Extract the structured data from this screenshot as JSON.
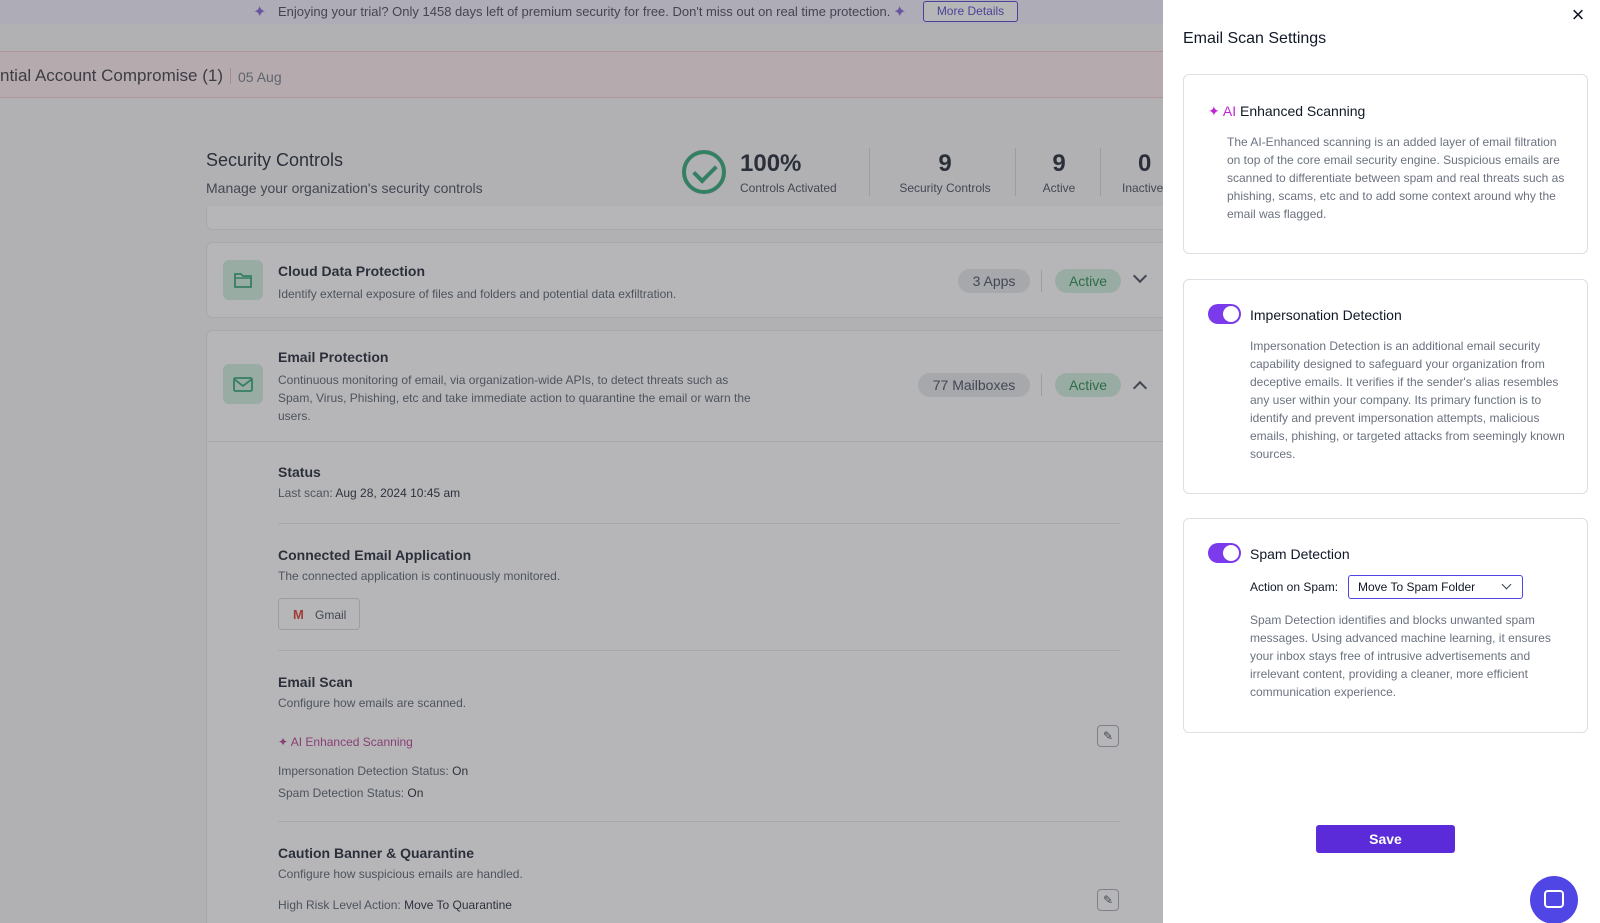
{
  "trial_banner": {
    "message": "Enjoying your trial? Only 1458 days left of premium security for free. Don't miss out on real time protection.",
    "button": "More Details"
  },
  "alert": {
    "title": "ntial Account Compromise (1)",
    "date": "05 Aug"
  },
  "security_controls": {
    "title": "Security Controls",
    "subtitle": "Manage your organization's security controls",
    "stats": [
      {
        "value": "100%",
        "label": "Controls Activated"
      },
      {
        "value": "9",
        "label": "Security Controls"
      },
      {
        "value": "9",
        "label": "Active"
      },
      {
        "value": "0",
        "label": "Inactive"
      }
    ]
  },
  "cloud_card": {
    "title": "Cloud Data Protection",
    "desc": "Identify external exposure of files and folders and potential data exfiltration.",
    "count": "3 Apps",
    "status": "Active"
  },
  "email_card": {
    "title": "Email Protection",
    "desc": "Continuous monitoring of email, via organization-wide APIs, to detect threats such as Spam, Virus, Phishing, etc and take immediate action to quarantine the email or warn the users.",
    "count": "77 Mailboxes",
    "status": "Active"
  },
  "status_section": {
    "title": "Status",
    "last_scan_label": "Last scan:",
    "last_scan_value": "Aug 28, 2024 10:45 am"
  },
  "connected_section": {
    "title": "Connected Email Application",
    "sub": "The connected application is continuously monitored.",
    "app": "Gmail"
  },
  "email_scan_section": {
    "title": "Email Scan",
    "sub": "Configure how emails are scanned.",
    "ai_label": "AI Enhanced Scanning",
    "impersonation_label": "Impersonation Detection Status:",
    "impersonation_value": "On",
    "spam_label": "Spam Detection Status:",
    "spam_value": "On"
  },
  "caution_section": {
    "title": "Caution Banner & Quarantine",
    "sub": "Configure how suspicious emails are handled.",
    "high_risk_label": "High Risk Level Action:",
    "high_risk_value": "Move To Quarantine"
  },
  "drawer": {
    "title": "Email Scan Settings",
    "ai_panel": {
      "badge": "AI",
      "title": "Enhanced Scanning",
      "desc": "The AI-Enhanced scanning is an added layer of email filtration on top of the core email security engine. Suspicious emails are scanned to differentiate between spam and real threats such as phishing, scams, etc and to add some context around why the email was flagged."
    },
    "impersonation_panel": {
      "title": "Impersonation Detection",
      "enabled": true,
      "desc": "Impersonation Detection is an additional email security capability designed to safeguard your organization from deceptive emails. It verifies if the sender's alias resembles any user within your company. Its primary function is to identify and prevent impersonation attempts, malicious emails, phishing, or targeted attacks from seemingly known sources."
    },
    "spam_panel": {
      "title": "Spam Detection",
      "enabled": true,
      "action_label": "Action on Spam:",
      "action_value": "Move To Spam Folder",
      "desc": "Spam Detection identifies and blocks unwanted spam messages. Using advanced machine learning, it ensures your inbox stays free of intrusive advertisements and irrelevant content, providing a cleaner, more efficient communication experience."
    },
    "save": "Save"
  },
  "colors": {
    "accent": "#5b2bd9",
    "toggle_on": "#7c3aed",
    "active_green": "#15803d",
    "ai_magenta": "#c026d3"
  }
}
